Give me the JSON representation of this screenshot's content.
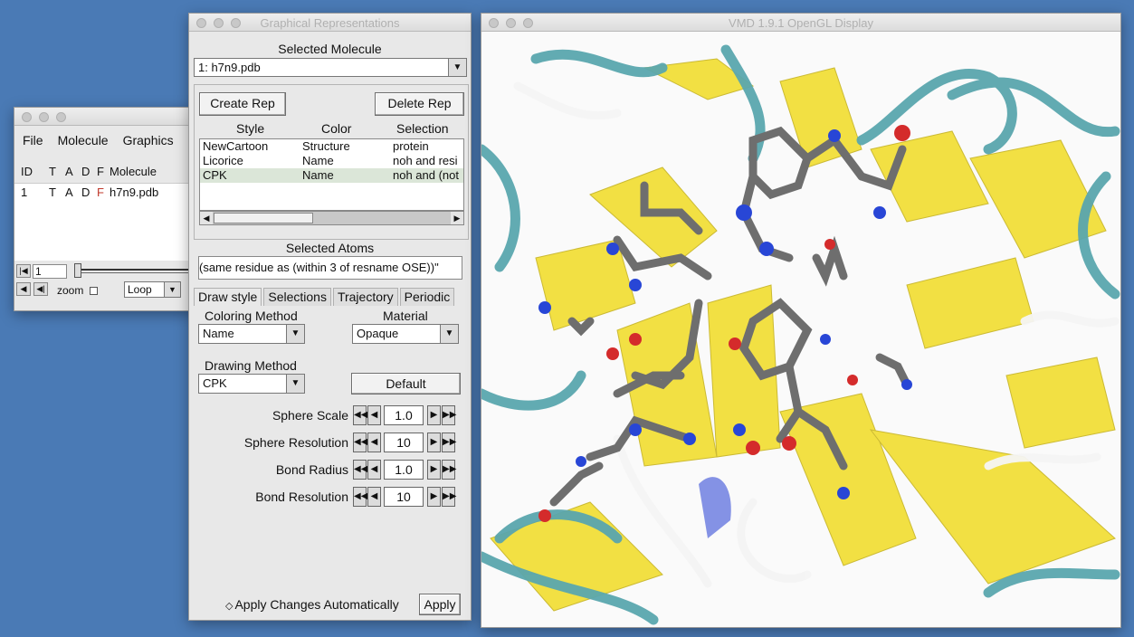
{
  "main_window": {
    "menu": [
      "File",
      "Molecule",
      "Graphics"
    ],
    "headers": [
      "ID",
      "T",
      "A",
      "D",
      "F",
      "Molecule"
    ],
    "rows": [
      {
        "id": "1",
        "t": "T",
        "a": "A",
        "d": "D",
        "f": "F",
        "molecule": "h7n9.pdb"
      }
    ],
    "frame_value": "1",
    "zoom_label": "zoom",
    "loop_value": "Loop"
  },
  "rep_window": {
    "title": "Graphical Representations",
    "selected_molecule_label": "Selected Molecule",
    "selected_molecule": "1: h7n9.pdb",
    "create_rep": "Create Rep",
    "delete_rep": "Delete Rep",
    "columns": [
      "Style",
      "Color",
      "Selection"
    ],
    "reps": [
      {
        "style": "NewCartoon",
        "color": "Structure",
        "selection": "protein"
      },
      {
        "style": "Licorice",
        "color": "Name",
        "selection": "noh and resi"
      },
      {
        "style": "CPK",
        "color": "Name",
        "selection": "noh and (not"
      }
    ],
    "selected_atoms_label": "Selected Atoms",
    "selected_atoms": "(same residue as (within 3 of resname OSE))\"",
    "tabs": [
      "Draw style",
      "Selections",
      "Trajectory",
      "Periodic"
    ],
    "coloring_method_label": "Coloring Method",
    "coloring_method": "Name",
    "material_label": "Material",
    "material": "Opaque",
    "drawing_method_label": "Drawing Method",
    "drawing_method": "CPK",
    "default_button": "Default",
    "params": [
      {
        "label": "Sphere Scale",
        "value": "1.0"
      },
      {
        "label": "Sphere Resolution",
        "value": "10"
      },
      {
        "label": "Bond Radius",
        "value": "1.0"
      },
      {
        "label": "Bond Resolution",
        "value": "10"
      }
    ],
    "apply_auto": "Apply Changes Automatically",
    "apply": "Apply"
  },
  "gl_window": {
    "title": "VMD 1.9.1 OpenGL Display"
  },
  "colors": {
    "desktop": "#4a7ab5",
    "ribbon_yellow": "#f2df3a",
    "ribbon_teal": "#5aa6ae",
    "atom_carbon": "#6e6e6e",
    "atom_oxygen": "#d42b2b",
    "atom_nitrogen": "#2846d6"
  }
}
